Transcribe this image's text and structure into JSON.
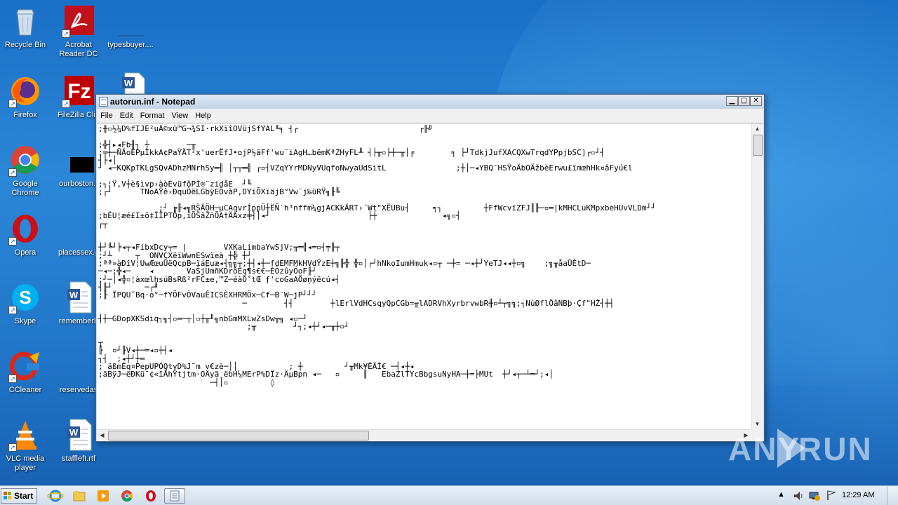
{
  "desktop": {
    "icons": [
      {
        "label": "Recycle Bin"
      },
      {
        "label": "Acrobat Reader DC"
      },
      {
        "label": "typesbuyer...."
      },
      {
        "label": "Firefox"
      },
      {
        "label": "FileZilla Clie"
      },
      {
        "label": "Google Chrome"
      },
      {
        "label": "ourboston.r"
      },
      {
        "label": "Opera"
      },
      {
        "label": "placessex.p"
      },
      {
        "label": "Skype"
      },
      {
        "label": "rememberb"
      },
      {
        "label": "CCleaner"
      },
      {
        "label": "reservedas"
      },
      {
        "label": "VLC media player"
      },
      {
        "label": "staffleft.rtf"
      }
    ]
  },
  "notepad": {
    "title": "autorun.inf - Notepad",
    "menu": [
      "File",
      "Edit",
      "Format",
      "View",
      "Help"
    ],
    "lines": [
      ";╫▫½¼D%fIJÉ²uÄ©xü™G¬¾ŠÌ·rkXïîOVüjŠfŸAL╙╕ ┤┌                          ┌╟╝",
      "",
      ";╬┤▸◂Fb╢┐ ┼        ─╥",
      ";╤┼─ÑÄoÉPµÌkkA¢PaŸÄT²x'uerËfJ•ojP½ãFf'wu¨iAgH…bêmKªZHyFL╨ ┤├╥▫├┼─╥│╒        ╕ ├┘TdkjJufXACQXwTrqdYPpjbSC]┌▫┘┤",
      "┤├◂│",
      "┘ ◂─KQKpTKLgSQvADhzMNrhSy═╢ │┬┬═╣ ┌▫┤VZqYYrMDNyVUqfoNwyaUdSitL               ;┼│─◂YBQ¯HSŸoÄbOÄžbèErwu£ïmœhHk¤âFyú€l",
      "",
      ";┐¦Ÿ,V┼è§ìvp›àòÈvüfôPÌ®¨zidåE  ┘╙",
      ";┌┘      TNoAŸê›ÐquÒëLGbÿEÕvàP,DYïÕXïäjB°Vw¨j‰üRŸ╗╟╚",
      "",
      "             ;┘ ╔╟◂╗RŠÄÖH─µCAqvrÍppÜ┼ËÑ˙h³nffm¼gjACKkÄRT›´Wt\"XËUBu┤     ╕┐         ┼FfWcvïZFJ║╟─▫═|kMHCLuKMpxbeHUvVLDm┘┘",
      ";bËU¦æé£I±ô‡ÏÎPTÒp,ïÕŠâŽñÕA†ÄÄxz╪┤│◂┘                     ├┼              ◂╗▫┤",
      "┌┬",
      "",
      "",
      "┼┘╚┘╞◂┬◂FibxDcy┬= |        VXKaLimbaYwSjV;╥═╣◂═▫┤╤╟┬",
      ";┘┴     ┬  ONVÇXëïWwnESwïeà ┼╬ ┼┘",
      ";ªª»àÐîV¦UwÆœuÜëQcpB─ïáEuæ◂┤╗╗┬;┼┤◂┼─fdEMFMkHVdŸzE┼╗╟╬ ╬▫│┌┘hNkoIumHmuk◂▫┬ ─┼= ─◂┼┘YeTJ◂◂┼▫╗    ;╗╥åaÜÊtD─",
      "─◂─;╬◂─    ◂       VaŠjÜmñKDrôÈq¶s€€─ÈÕzûyÖoF╟┘",
      ";┘─│◂╬▫¦àxœlhsúBsRß²rFC±e,™Z─éàÕ˚tŒ ƒ'coGaAÖøņýêcú◂┤",
      "┤╟┘       ─┌╜",
      ";╟ ÏPQU˜Bq·o°─fYÖFvÒVauÊICSÈXHRMÖx─Cf─B¨W─jP┘┘┘",
      "                               ─        ┤┤        ┼lErlVdHCsqyQpCGb=╥lADRVhXyrbrvwbR╫▫┴┬╗╗;┐NùØflÕâNBþ·Çf\"HŽ┤┼┤",
      "",
      "┤┼─GDopXKSdiq┐╗┤▫═─┬│▫┼╥╜╗nbGmMXLwZsDw╥╗ ◂▫─┘",
      "                                ;╥        ┘┐;◂┼┘◂─╥┼▫┘",
      "",
      "┬",
      "╟  ▫┘╟V◂┼─═◂▫┼┤◂",
      "┐┤  ;◂┼┘┼═",
      "; äßmÉq¤PepUPÓQtyD%J˜m v€zè─││           ; ┼         ┘╥Mk¥ËÄÌ€ ─┤◂┼◂",
      ";äBÿJ─ëÐKü¯¢«ïÅhŸtjtm·OÄyä¸ëbH¼MErP%DÏz·ÄµBpn ◂─   ▫     ║   EbaZlTYcBbgsuNyHA─┼=├MUt  ┼┘◂┬─┴═┘;◂│",
      "                        ─┤│▫         ◊"
    ]
  },
  "watermark": {
    "left": "ANY",
    "right": "RUN"
  },
  "taskbar": {
    "start_label": "Start",
    "clock": "12:29 AM"
  }
}
